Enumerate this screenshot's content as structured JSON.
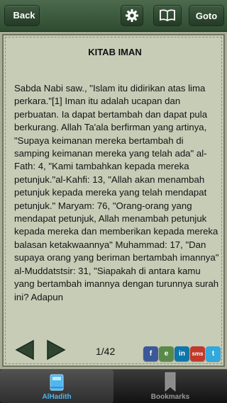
{
  "topbar": {
    "back_label": "Back",
    "goto_label": "Goto",
    "settings_icon": "gear-icon",
    "book_icon": "open-book-icon"
  },
  "content": {
    "title": "KITAB IMAN",
    "body": "Sabda Nabi saw., \"Islam itu didirikan atas lima perkara.\"[1] Iman itu adalah ucapan dan perbuatan. Ia dapat bertambah dan dapat pula berkurang. Allah Ta'ala berfirman yang artinya, \"Supaya keimanan mereka bertambah di samping keimanan mereka yang telah ada\" al-Fath: 4, \"Kami tambahkan kepada mereka petunjuk.\"al-Kahfi: 13, \"Allah akan menambah petunjuk kepada mereka yang telah mendapat petunjuk.\" Maryam: 76, \"Orang-orang yang mendapat petunjuk, Allah menambah petunjuk kepada mereka dan memberikan kepada mereka balasan ketakwaannya\" Muhammad: 17, \"Dan supaya orang yang beriman bertambah imannya\" al-Muddatstsir: 31, \"Siapakah di antara kamu yang bertambah imannya dengan turunnya surah ini? Adapun"
  },
  "pager": {
    "indicator": "1/42"
  },
  "share": [
    {
      "label": "f",
      "icon": "facebook-icon",
      "color": "#3b5998"
    },
    {
      "label": "e",
      "icon": "evernote-icon",
      "color": "#5a8a4a"
    },
    {
      "label": "in",
      "icon": "linkedin-icon",
      "color": "#0e76a8"
    },
    {
      "label": "sms",
      "icon": "sms-icon",
      "color": "#c0392b"
    },
    {
      "label": "t",
      "icon": "twitter-icon",
      "color": "#33a8dd"
    }
  ],
  "tabs": [
    {
      "label": "AlHadith",
      "icon": "book-icon",
      "active": true,
      "color": "#4fb6f2"
    },
    {
      "label": "Bookmarks",
      "icon": "bookmark-icon",
      "active": false,
      "color": "#9a9a9a"
    }
  ]
}
